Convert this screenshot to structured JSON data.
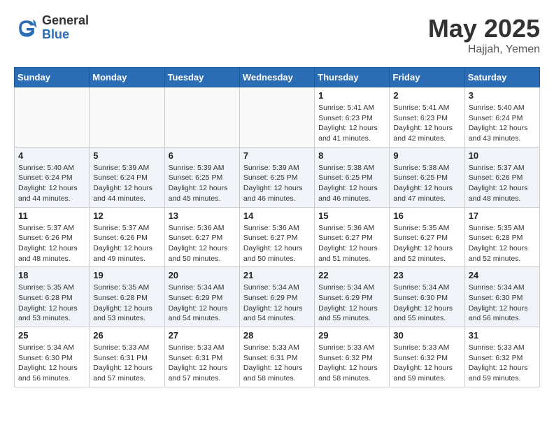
{
  "header": {
    "logo_general": "General",
    "logo_blue": "Blue",
    "title_month": "May 2025",
    "title_location": "Hajjah, Yemen"
  },
  "calendar": {
    "days_of_week": [
      "Sunday",
      "Monday",
      "Tuesday",
      "Wednesday",
      "Thursday",
      "Friday",
      "Saturday"
    ],
    "weeks": [
      [
        {
          "day": "",
          "sunrise": "",
          "sunset": "",
          "daylight": ""
        },
        {
          "day": "",
          "sunrise": "",
          "sunset": "",
          "daylight": ""
        },
        {
          "day": "",
          "sunrise": "",
          "sunset": "",
          "daylight": ""
        },
        {
          "day": "",
          "sunrise": "",
          "sunset": "",
          "daylight": ""
        },
        {
          "day": "1",
          "sunrise": "Sunrise: 5:41 AM",
          "sunset": "Sunset: 6:23 PM",
          "daylight": "Daylight: 12 hours and 41 minutes."
        },
        {
          "day": "2",
          "sunrise": "Sunrise: 5:41 AM",
          "sunset": "Sunset: 6:23 PM",
          "daylight": "Daylight: 12 hours and 42 minutes."
        },
        {
          "day": "3",
          "sunrise": "Sunrise: 5:40 AM",
          "sunset": "Sunset: 6:24 PM",
          "daylight": "Daylight: 12 hours and 43 minutes."
        }
      ],
      [
        {
          "day": "4",
          "sunrise": "Sunrise: 5:40 AM",
          "sunset": "Sunset: 6:24 PM",
          "daylight": "Daylight: 12 hours and 44 minutes."
        },
        {
          "day": "5",
          "sunrise": "Sunrise: 5:39 AM",
          "sunset": "Sunset: 6:24 PM",
          "daylight": "Daylight: 12 hours and 44 minutes."
        },
        {
          "day": "6",
          "sunrise": "Sunrise: 5:39 AM",
          "sunset": "Sunset: 6:25 PM",
          "daylight": "Daylight: 12 hours and 45 minutes."
        },
        {
          "day": "7",
          "sunrise": "Sunrise: 5:39 AM",
          "sunset": "Sunset: 6:25 PM",
          "daylight": "Daylight: 12 hours and 46 minutes."
        },
        {
          "day": "8",
          "sunrise": "Sunrise: 5:38 AM",
          "sunset": "Sunset: 6:25 PM",
          "daylight": "Daylight: 12 hours and 46 minutes."
        },
        {
          "day": "9",
          "sunrise": "Sunrise: 5:38 AM",
          "sunset": "Sunset: 6:25 PM",
          "daylight": "Daylight: 12 hours and 47 minutes."
        },
        {
          "day": "10",
          "sunrise": "Sunrise: 5:37 AM",
          "sunset": "Sunset: 6:26 PM",
          "daylight": "Daylight: 12 hours and 48 minutes."
        }
      ],
      [
        {
          "day": "11",
          "sunrise": "Sunrise: 5:37 AM",
          "sunset": "Sunset: 6:26 PM",
          "daylight": "Daylight: 12 hours and 48 minutes."
        },
        {
          "day": "12",
          "sunrise": "Sunrise: 5:37 AM",
          "sunset": "Sunset: 6:26 PM",
          "daylight": "Daylight: 12 hours and 49 minutes."
        },
        {
          "day": "13",
          "sunrise": "Sunrise: 5:36 AM",
          "sunset": "Sunset: 6:27 PM",
          "daylight": "Daylight: 12 hours and 50 minutes."
        },
        {
          "day": "14",
          "sunrise": "Sunrise: 5:36 AM",
          "sunset": "Sunset: 6:27 PM",
          "daylight": "Daylight: 12 hours and 50 minutes."
        },
        {
          "day": "15",
          "sunrise": "Sunrise: 5:36 AM",
          "sunset": "Sunset: 6:27 PM",
          "daylight": "Daylight: 12 hours and 51 minutes."
        },
        {
          "day": "16",
          "sunrise": "Sunrise: 5:35 AM",
          "sunset": "Sunset: 6:27 PM",
          "daylight": "Daylight: 12 hours and 52 minutes."
        },
        {
          "day": "17",
          "sunrise": "Sunrise: 5:35 AM",
          "sunset": "Sunset: 6:28 PM",
          "daylight": "Daylight: 12 hours and 52 minutes."
        }
      ],
      [
        {
          "day": "18",
          "sunrise": "Sunrise: 5:35 AM",
          "sunset": "Sunset: 6:28 PM",
          "daylight": "Daylight: 12 hours and 53 minutes."
        },
        {
          "day": "19",
          "sunrise": "Sunrise: 5:35 AM",
          "sunset": "Sunset: 6:28 PM",
          "daylight": "Daylight: 12 hours and 53 minutes."
        },
        {
          "day": "20",
          "sunrise": "Sunrise: 5:34 AM",
          "sunset": "Sunset: 6:29 PM",
          "daylight": "Daylight: 12 hours and 54 minutes."
        },
        {
          "day": "21",
          "sunrise": "Sunrise: 5:34 AM",
          "sunset": "Sunset: 6:29 PM",
          "daylight": "Daylight: 12 hours and 54 minutes."
        },
        {
          "day": "22",
          "sunrise": "Sunrise: 5:34 AM",
          "sunset": "Sunset: 6:29 PM",
          "daylight": "Daylight: 12 hours and 55 minutes."
        },
        {
          "day": "23",
          "sunrise": "Sunrise: 5:34 AM",
          "sunset": "Sunset: 6:30 PM",
          "daylight": "Daylight: 12 hours and 55 minutes."
        },
        {
          "day": "24",
          "sunrise": "Sunrise: 5:34 AM",
          "sunset": "Sunset: 6:30 PM",
          "daylight": "Daylight: 12 hours and 56 minutes."
        }
      ],
      [
        {
          "day": "25",
          "sunrise": "Sunrise: 5:34 AM",
          "sunset": "Sunset: 6:30 PM",
          "daylight": "Daylight: 12 hours and 56 minutes."
        },
        {
          "day": "26",
          "sunrise": "Sunrise: 5:33 AM",
          "sunset": "Sunset: 6:31 PM",
          "daylight": "Daylight: 12 hours and 57 minutes."
        },
        {
          "day": "27",
          "sunrise": "Sunrise: 5:33 AM",
          "sunset": "Sunset: 6:31 PM",
          "daylight": "Daylight: 12 hours and 57 minutes."
        },
        {
          "day": "28",
          "sunrise": "Sunrise: 5:33 AM",
          "sunset": "Sunset: 6:31 PM",
          "daylight": "Daylight: 12 hours and 58 minutes."
        },
        {
          "day": "29",
          "sunrise": "Sunrise: 5:33 AM",
          "sunset": "Sunset: 6:32 PM",
          "daylight": "Daylight: 12 hours and 58 minutes."
        },
        {
          "day": "30",
          "sunrise": "Sunrise: 5:33 AM",
          "sunset": "Sunset: 6:32 PM",
          "daylight": "Daylight: 12 hours and 59 minutes."
        },
        {
          "day": "31",
          "sunrise": "Sunrise: 5:33 AM",
          "sunset": "Sunset: 6:32 PM",
          "daylight": "Daylight: 12 hours and 59 minutes."
        }
      ]
    ]
  }
}
